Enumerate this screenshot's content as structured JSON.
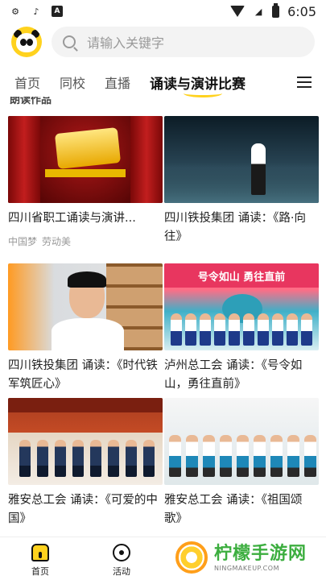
{
  "status_bar": {
    "time": "6:05",
    "left_icons": [
      "gear-icon",
      "tiktok-icon",
      "a-icon"
    ],
    "right_icons": [
      "wifi-icon",
      "no-signal-icon",
      "battery-icon"
    ]
  },
  "header": {
    "logo": "panda-logo",
    "search_placeholder": "请输入关键字"
  },
  "tabs": [
    {
      "label": "首页",
      "active": false
    },
    {
      "label": "同校",
      "active": false
    },
    {
      "label": "直播",
      "active": false
    },
    {
      "label": "诵读与演讲比赛",
      "active": true
    }
  ],
  "section_title_partial": "朗读作品",
  "cards": [
    {
      "title": "四川省职工诵读与演讲...",
      "tags": [
        "中国梦",
        "劳动美"
      ]
    },
    {
      "title": "四川铁投集团 诵读：《路·向往》"
    },
    {
      "title": "四川铁投集团 诵读：《时代铁军筑匠心》"
    },
    {
      "title": "泸州总工会 诵读：《号令如山，勇往直前》",
      "thumb_banner": "号令如山   勇往直前"
    },
    {
      "title": "雅安总工会 诵读：《可爱的中国》"
    },
    {
      "title": "雅安总工会 诵读：《祖国颂歌》"
    }
  ],
  "bottom_nav": [
    {
      "label": "首页",
      "icon": "home-icon",
      "active": true
    },
    {
      "label": "活动",
      "icon": "activity-icon",
      "active": false
    }
  ],
  "watermark": {
    "main": "柠檬手游网",
    "sub": "NINGMAKEUP.COM"
  },
  "colors": {
    "accent": "#ffd21e",
    "watermark_green": "#3cae3f"
  }
}
